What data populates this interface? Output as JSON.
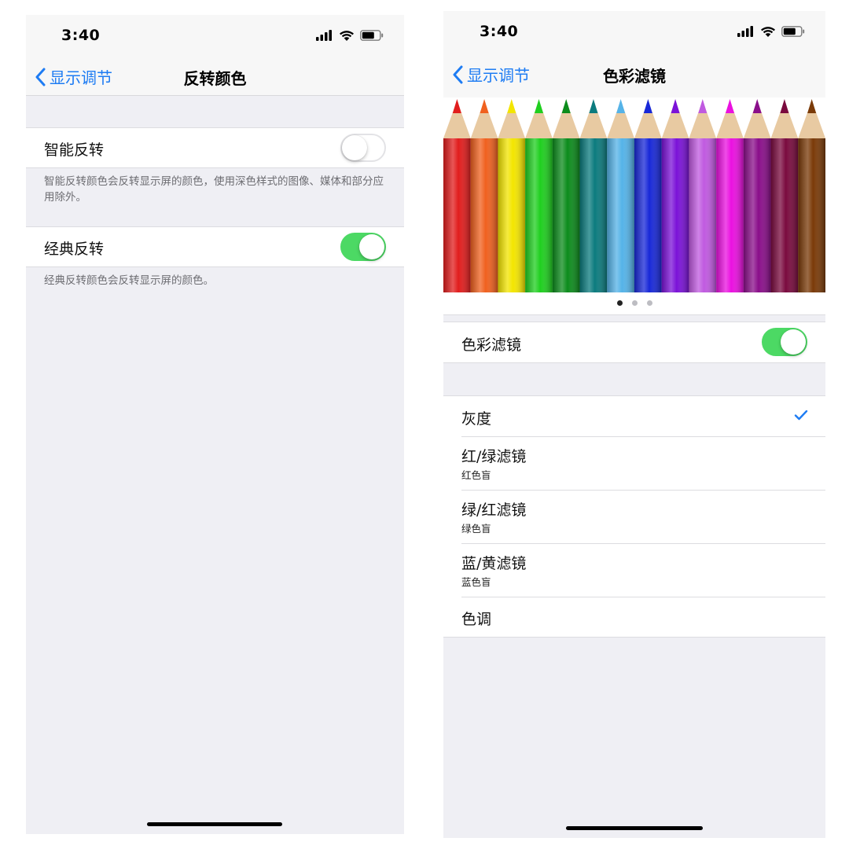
{
  "left_screen": {
    "status": {
      "time": "3:40"
    },
    "nav": {
      "back_label": "显示调节",
      "title": "反转颜色"
    },
    "smart_invert": {
      "label": "智能反转",
      "enabled": false
    },
    "smart_invert_footer": "智能反转颜色会反转显示屏的颜色，使用深色样式的图像、媒体和部分应用除外。",
    "classic_invert": {
      "label": "经典反转",
      "enabled": true
    },
    "classic_invert_footer": "经典反转颜色会反转显示屏的颜色。"
  },
  "right_screen": {
    "status": {
      "time": "3:40"
    },
    "nav": {
      "back_label": "显示调节",
      "title": "色彩滤镜"
    },
    "pencil_colors": [
      "#e11d1d",
      "#f0611f",
      "#f3e500",
      "#1fcf1f",
      "#0c8c1c",
      "#0b7b7e",
      "#55b3e8",
      "#1828d8",
      "#7b12d8",
      "#c05ae0",
      "#ea10e0",
      "#8a0e8a",
      "#7a0a3e",
      "#7a3a08"
    ],
    "page_dots": {
      "count": 3,
      "active": 0
    },
    "color_filters": {
      "label": "色彩滤镜",
      "enabled": true
    },
    "filters": [
      {
        "title": "灰度",
        "subtitle": "",
        "selected": true
      },
      {
        "title": "红/绿滤镜",
        "subtitle": "红色盲",
        "selected": false
      },
      {
        "title": "绿/红滤镜",
        "subtitle": "绿色盲",
        "selected": false
      },
      {
        "title": "蓝/黄滤镜",
        "subtitle": "蓝色盲",
        "selected": false
      },
      {
        "title": "色调",
        "subtitle": "",
        "selected": false
      }
    ]
  },
  "colors": {
    "accent": "#1e7cf3",
    "toggle_on": "#4cd964",
    "background": "#efeff4"
  }
}
